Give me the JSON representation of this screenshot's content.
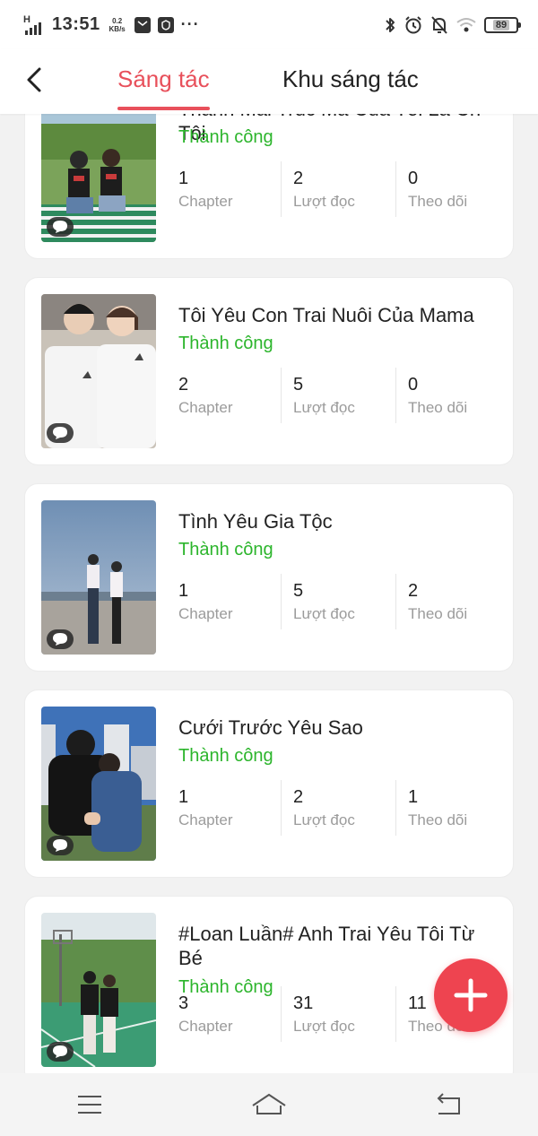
{
  "status_bar": {
    "network": "H",
    "time": "13:51",
    "speed_value": "0.2",
    "speed_unit": "KB/s",
    "more": "···",
    "battery": "89"
  },
  "header": {
    "tabs": [
      {
        "label": "Sáng tác",
        "active": true
      },
      {
        "label": "Khu sáng tác",
        "active": false
      }
    ],
    "accent_color": "#e8505b"
  },
  "stories": [
    {
      "title": "Thanh Mai Trúc Mã Của Tôi Là Ch Tôi",
      "status": "Thành công",
      "chapters": "1",
      "chapters_label": "Chapter",
      "reads": "2",
      "reads_label": "Lượt đọc",
      "follows": "0",
      "follows_label": "Theo dõi"
    },
    {
      "title": "Tôi Yêu Con Trai Nuôi Của Mama",
      "status": "Thành công",
      "chapters": "2",
      "chapters_label": "Chapter",
      "reads": "5",
      "reads_label": "Lượt đọc",
      "follows": "0",
      "follows_label": "Theo dõi"
    },
    {
      "title": "Tình Yêu Gia Tộc",
      "status": "Thành công",
      "chapters": "1",
      "chapters_label": "Chapter",
      "reads": "5",
      "reads_label": "Lượt đọc",
      "follows": "2",
      "follows_label": "Theo dõi"
    },
    {
      "title": "Cưới Trước Yêu Sao",
      "status": "Thành công",
      "chapters": "1",
      "chapters_label": "Chapter",
      "reads": "2",
      "reads_label": "Lượt đọc",
      "follows": "1",
      "follows_label": "Theo dõi"
    },
    {
      "title": "#Loan Luần# Anh Trai Yêu Tôi Từ Bé",
      "status": "Thành công",
      "chapters": "3",
      "chapters_label": "Chapter",
      "reads": "31",
      "reads_label": "Lượt đọc",
      "follows": "11",
      "follows_label": "Theo dõi"
    }
  ],
  "colors": {
    "status_success": "#2cb52c",
    "fab": "#ee4450"
  },
  "icons": {
    "back": "chevron-left-icon",
    "fab": "plus-icon",
    "comment": "chat-bubble-icon",
    "nav_menu": "menu-icon",
    "nav_home": "home-icon",
    "nav_back": "return-icon"
  }
}
